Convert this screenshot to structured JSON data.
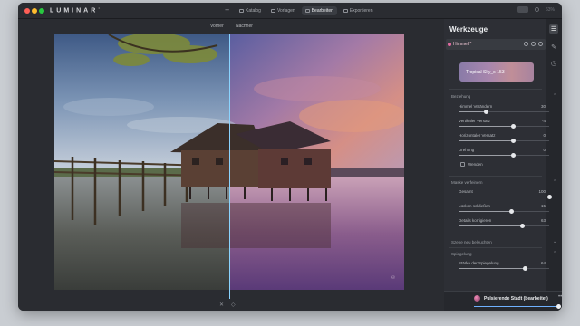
{
  "app": {
    "logo": "LUMINAR",
    "version_sup": "4"
  },
  "titlebar": {
    "nav": [
      {
        "label": "Katalog",
        "active": false
      },
      {
        "label": "Vorlagen",
        "active": false
      },
      {
        "label": "Bearbeiten",
        "active": true
      },
      {
        "label": "Exportieren",
        "active": false
      }
    ],
    "zoom": "63%"
  },
  "canvas": {
    "before_label": "Vorher",
    "after_label": "Nachher",
    "split_position": 0.5
  },
  "panel": {
    "title": "Werkzeuge",
    "layer": {
      "name": "Himmel *",
      "icon": "sky-icon"
    },
    "sky_preset": "Tropical Sky_s-153",
    "sections": {
      "beziehung": "Beziehung",
      "maske": "Maske verfeinern",
      "szene": "Szene neu beleuchten",
      "spiegelung": "Spiegelung"
    },
    "sliders_beziehung": [
      {
        "label": "Himmel Verändern",
        "value": "30",
        "fraction": 0.3
      },
      {
        "label": "Vertikaler Versatz",
        "value": "-4",
        "fraction": 0.6
      },
      {
        "label": "Horizontaler Versatz",
        "value": "0",
        "fraction": 0.6
      },
      {
        "label": "Drehung",
        "value": "0",
        "fraction": 0.6
      }
    ],
    "flip_label": "Wenden",
    "sliders_maske": [
      {
        "label": "Gesamt",
        "value": "100",
        "fraction": 1.0
      },
      {
        "label": "Lücken schließen",
        "value": "15",
        "fraction": 0.58
      },
      {
        "label": "Details korrigieren",
        "value": "63",
        "fraction": 0.7
      }
    ],
    "sliders_spiegelung": [
      {
        "label": "Stärke der Spiegelung",
        "value": "64",
        "fraction": 0.73
      }
    ]
  },
  "bottom_bar": {
    "preset_name": "Pulsierende Stadt (bearbeitet)",
    "more": "•••",
    "amount_fraction": 1.0
  },
  "colors": {
    "accent": "#6fb1ff",
    "divider": "#8ad4ff",
    "layer_pink": "#e06aa0"
  }
}
